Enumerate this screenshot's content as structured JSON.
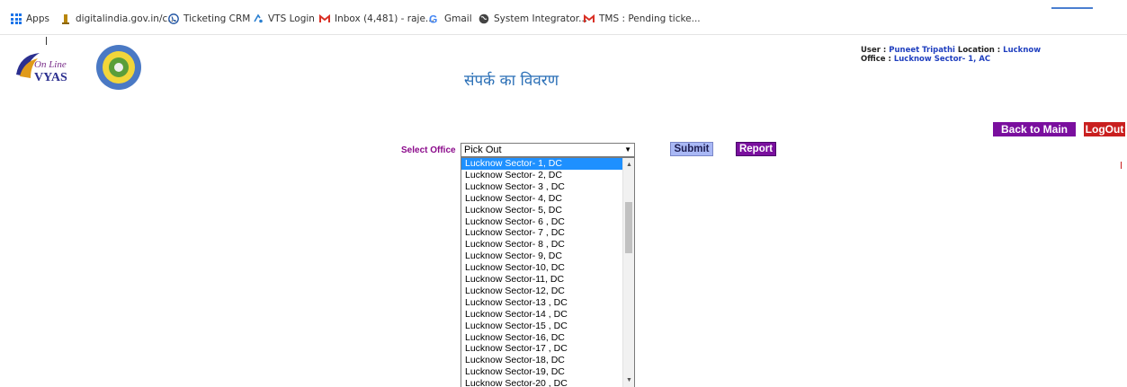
{
  "bookmarks": [
    {
      "label": "Apps",
      "icon": "apps-grid-icon"
    },
    {
      "label": "digitalindia.gov.in/c...",
      "icon": "emblem-icon"
    },
    {
      "label": "Ticketing CRM",
      "icon": "phone-icon"
    },
    {
      "label": "VTS Login",
      "icon": "location-icon"
    },
    {
      "label": "Inbox (4,481) - raje...",
      "icon": "gmail-icon"
    },
    {
      "label": "Gmail",
      "icon": "google-icon"
    },
    {
      "label": "System Integrator...",
      "icon": "globe-icon"
    },
    {
      "label": "TMS : Pending ticke...",
      "icon": "gmail-icon"
    }
  ],
  "header": {
    "logo_text_top": "On Line",
    "logo_text_bottom": "VYAS",
    "title": "संपर्क का विवरण"
  },
  "user_info": {
    "user_label": "User :",
    "user_value": "Puneet Tripathi",
    "location_label": "Location :",
    "location_value": "Lucknow",
    "office_label": "Office :",
    "office_value": "Lucknow Sector- 1, AC"
  },
  "actions": {
    "back_label": "Back to Main Menu",
    "logout_label": "LogOut"
  },
  "form": {
    "select_label": "Select Office",
    "selected_value": "Pick Out",
    "submit_label": "Submit",
    "report_label": "Report"
  },
  "dropdown_options": [
    "Lucknow Sector- 1, DC",
    "Lucknow Sector- 2, DC",
    "Lucknow Sector- 3 , DC",
    "Lucknow Sector- 4, DC",
    "Lucknow Sector- 5, DC",
    "Lucknow Sector- 6 , DC",
    "Lucknow Sector- 7 , DC",
    "Lucknow Sector- 8 , DC",
    "Lucknow Sector- 9, DC",
    "Lucknow Sector-10, DC",
    "Lucknow Sector-11, DC",
    "Lucknow Sector-12, DC",
    "Lucknow Sector-13 , DC",
    "Lucknow Sector-14 , DC",
    "Lucknow Sector-15 , DC",
    "Lucknow Sector-16, DC",
    "Lucknow Sector-17 , DC",
    "Lucknow Sector-18, DC",
    "Lucknow Sector-19, DC",
    "Lucknow Sector-20 , DC"
  ],
  "highlighted_option_index": 0,
  "colors": {
    "title": "#2a6fb6",
    "purple_button": "#7a0f9e",
    "logout": "#c91f1f",
    "submit": "#a9b8f5",
    "highlight": "#1e90ff"
  }
}
